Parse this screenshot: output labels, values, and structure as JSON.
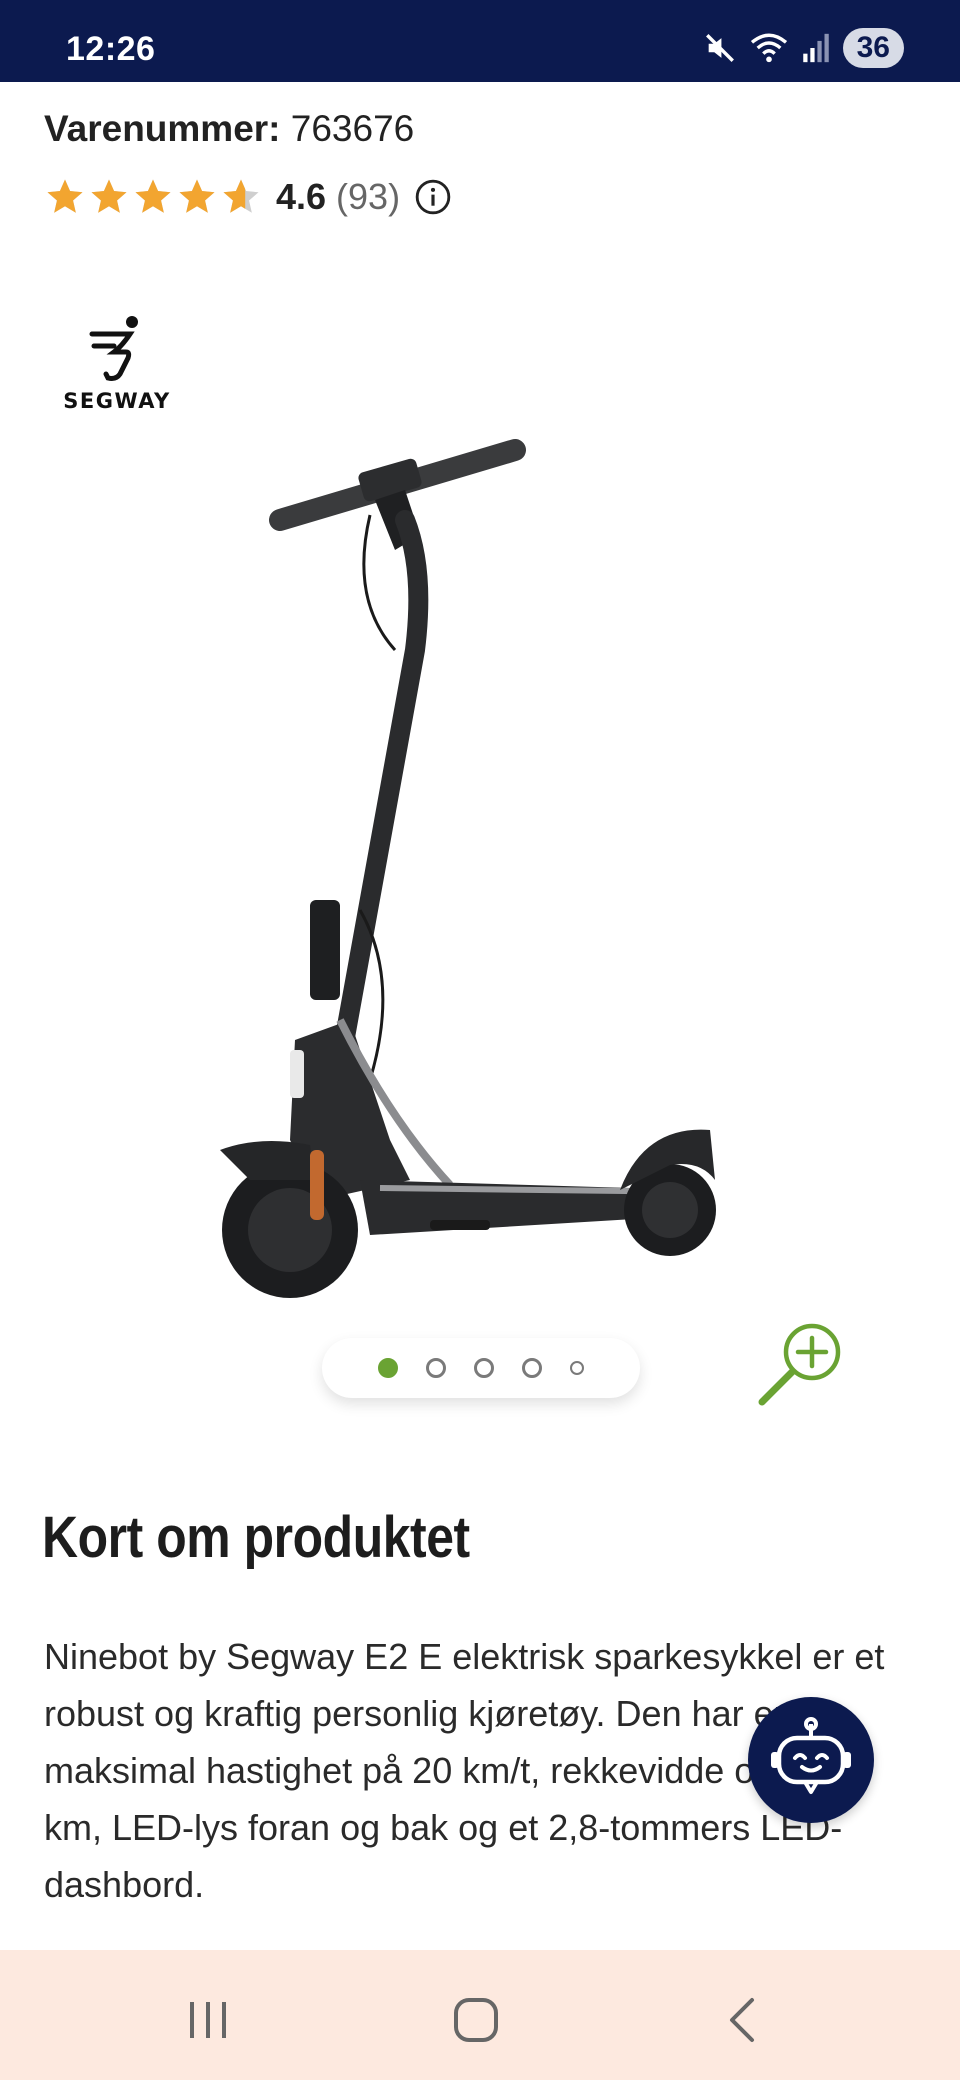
{
  "status": {
    "time": "12:26",
    "battery": "36",
    "icons": [
      "mute-icon",
      "wifi-icon",
      "signal-icon"
    ]
  },
  "product": {
    "sku_label": "Varenummer:",
    "sku_value": "763676",
    "rating_value": "4.6",
    "rating_count": "(93)",
    "rating_fraction": 0.92,
    "brand": "SEGWAY"
  },
  "carousel": {
    "slide_count": 5,
    "active_index": 0
  },
  "section": {
    "title": "Kort om produktet",
    "description": "Ninebot by Segway E2 E elektrisk sparkesykkel er et robust og kraftig personlig kjøretøy. Den har en maksimal hastighet på 20 km/t, rekkevidde opptil 25 km, LED-lys foran og bak og et 2,8-tommers LED-dashbord."
  },
  "colors": {
    "status_bar": "#0c1a4f",
    "star": "#f2a530",
    "accent_green": "#6aa333",
    "nav_bar": "#fde9df"
  }
}
